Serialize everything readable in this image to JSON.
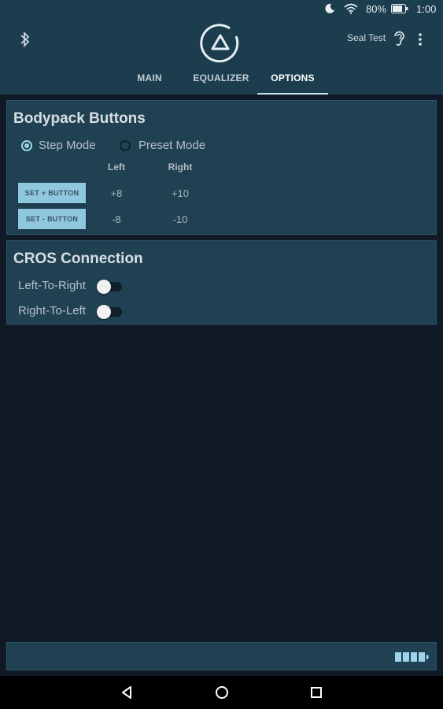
{
  "status_bar": {
    "battery_percent": "80%",
    "time": "1:00"
  },
  "header": {
    "device_name": "Seal Test",
    "tabs": [
      {
        "label": "MAIN",
        "active": false
      },
      {
        "label": "EQUALIZER",
        "active": false
      },
      {
        "label": "OPTIONS",
        "active": true
      }
    ]
  },
  "bodypack": {
    "title": "Bodypack Buttons",
    "modes": [
      {
        "label": "Step Mode",
        "selected": true
      },
      {
        "label": "Preset Mode",
        "selected": false
      }
    ],
    "columns": [
      "Left",
      "Right"
    ],
    "rows": [
      {
        "button": "SET + BUTTON",
        "left": "+8",
        "right": "+10"
      },
      {
        "button": "SET - BUTTON",
        "left": "-8",
        "right": "-10"
      }
    ]
  },
  "cros": {
    "title": "CROS Connection",
    "toggles": [
      {
        "label": "Left-To-Right",
        "on": false
      },
      {
        "label": "Right-To-Left",
        "on": false
      }
    ]
  },
  "colors": {
    "header_bg": "#1b3d4e",
    "panel_bg": "#1f4152",
    "page_bg": "#0f1a26",
    "accent": "#9fd3ea"
  },
  "icons": {
    "status": [
      "moon-icon",
      "wifi-icon",
      "battery-icon"
    ],
    "header": [
      "bluetooth-icon",
      "logo-icon",
      "ear-icon",
      "more-vert-icon"
    ],
    "footer": [
      "battery-level-icon"
    ],
    "nav": [
      "back-icon",
      "home-icon",
      "recents-icon"
    ]
  }
}
